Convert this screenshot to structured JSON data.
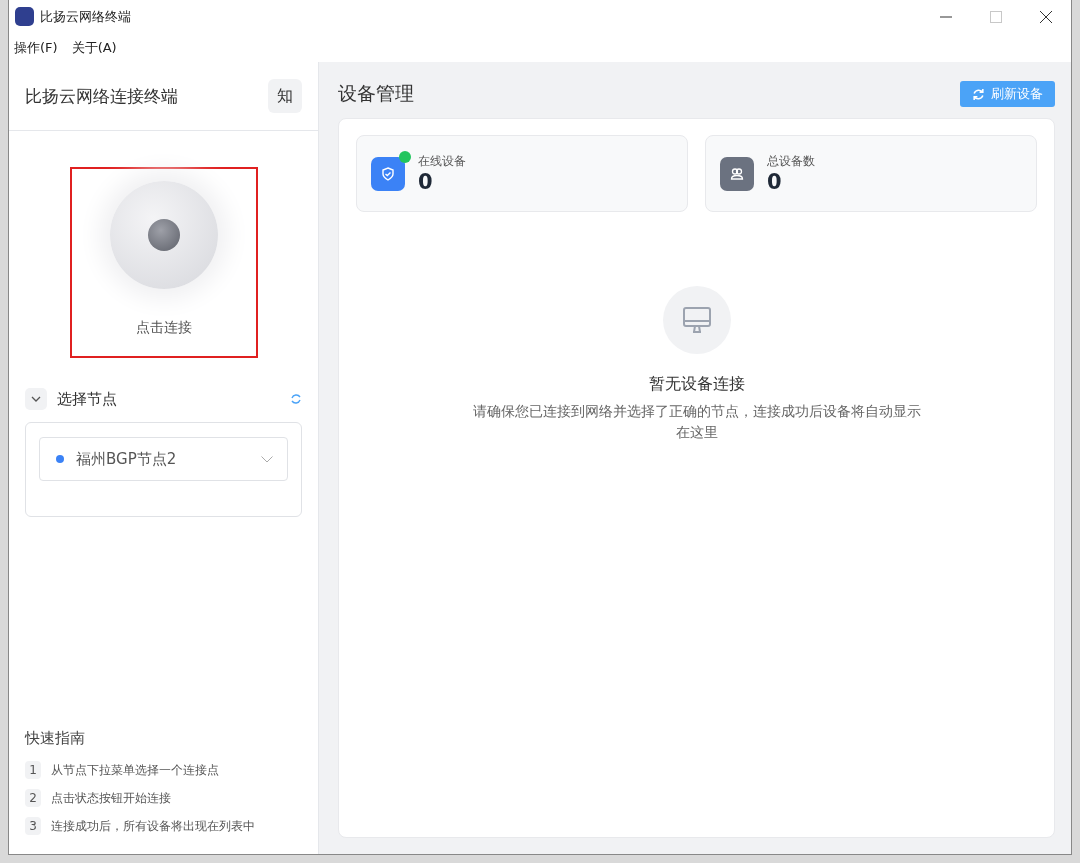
{
  "window": {
    "title": "比扬云网络终端"
  },
  "menu": [
    "操作(F)",
    "关于(A)"
  ],
  "sidebar": {
    "app_name": "比扬云网络连接终端",
    "avatar": "知",
    "connect": {
      "label": "点击连接",
      "connected": false
    },
    "node_section": {
      "title": "选择节点",
      "expanded": true,
      "selected_node": "福州BGP节点2"
    },
    "guide": {
      "title": "快速指南",
      "steps": [
        {
          "number": "1",
          "text": "从节点下拉菜单选择一个连接点"
        },
        {
          "number": "2",
          "text": "点击状态按钮开始连接"
        },
        {
          "number": "3",
          "text": "连接成功后，所有设备将出现在列表中"
        }
      ]
    }
  },
  "main": {
    "title": "设备管理",
    "refresh_button": "刷新设备",
    "stats": [
      {
        "kind": "online",
        "label": "在线设备",
        "value": "0"
      },
      {
        "kind": "total",
        "label": "总设备数",
        "value": "0"
      }
    ],
    "empty_state": {
      "title": "暂无设备连接",
      "message": "请确保您已连接到网络并选择了正确的节点，连接成功后设备将自动显示在这里"
    }
  }
}
